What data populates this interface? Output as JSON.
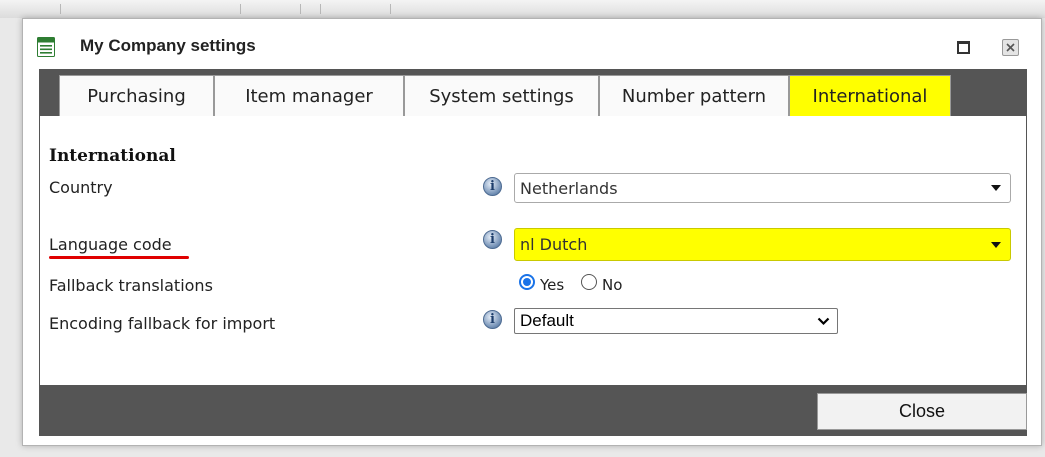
{
  "window": {
    "title": "My Company settings",
    "icons": {
      "app": "settings-sheet-icon",
      "maximize": "maximize-icon",
      "close": "close-icon"
    }
  },
  "tabs": [
    {
      "label": "Purchasing",
      "active": false
    },
    {
      "label": "Item manager",
      "active": false
    },
    {
      "label": "System settings",
      "active": false
    },
    {
      "label": "Number pattern",
      "active": false
    },
    {
      "label": "International",
      "active": true
    }
  ],
  "section": {
    "title": "International",
    "fields": {
      "country": {
        "label": "Country",
        "value": "Netherlands",
        "icon": "info-icon"
      },
      "language_code": {
        "label": "Language code",
        "value": "nl Dutch",
        "icon": "info-icon",
        "highlight": "#ffff00"
      },
      "fallback_translations": {
        "label": "Fallback translations",
        "options": [
          "Yes",
          "No"
        ],
        "selected": "Yes"
      },
      "encoding_fallback": {
        "label": "Encoding fallback for import",
        "value": "Default",
        "icon": "info-icon"
      }
    }
  },
  "footer": {
    "close_label": "Close"
  },
  "colors": {
    "highlight": "#ffff00",
    "dark_bar": "#555555",
    "annotation_underline": "#e00000",
    "radio_accent": "#1a73e8"
  }
}
